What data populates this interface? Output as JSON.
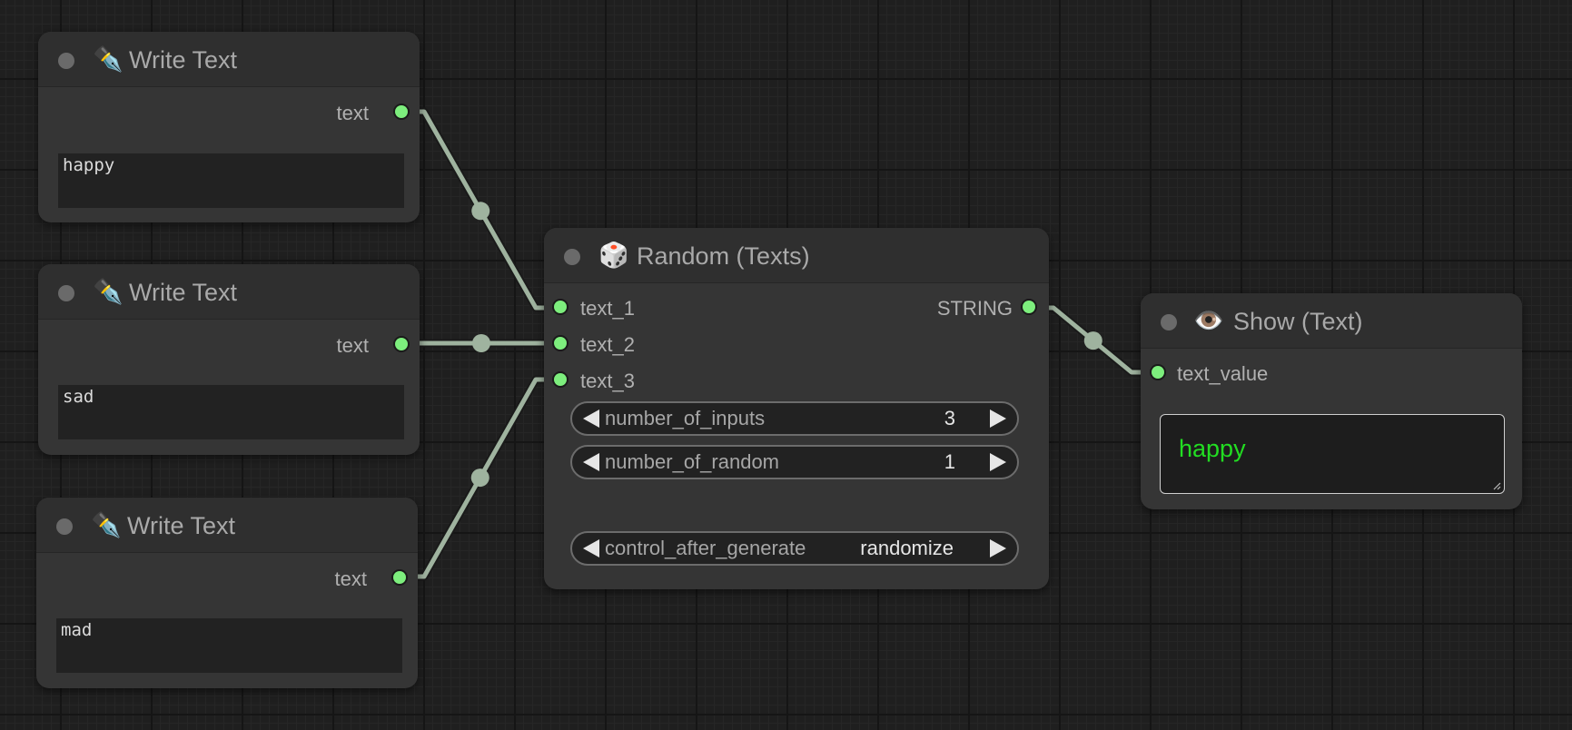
{
  "canvas": {
    "link_color": "#9fb39f",
    "slot_color": "#7dee7d",
    "show_text_color": "#22dd22"
  },
  "write_text_nodes": [
    {
      "icon": "✒️",
      "title": "Write Text",
      "output_label": "text",
      "value": "happy"
    },
    {
      "icon": "✒️",
      "title": "Write Text",
      "output_label": "text",
      "value": "sad"
    },
    {
      "icon": "✒️",
      "title": "Write Text",
      "output_label": "text",
      "value": "mad"
    }
  ],
  "random_node": {
    "icon": "🎲",
    "title": "Random (Texts)",
    "inputs": [
      "text_1",
      "text_2",
      "text_3"
    ],
    "output_label": "STRING",
    "widgets": [
      {
        "name": "number_of_inputs",
        "value": "3"
      },
      {
        "name": "number_of_random",
        "value": "1"
      },
      {
        "name": "control_after_generate",
        "value": "randomize"
      }
    ]
  },
  "show_node": {
    "icon": "👁️",
    "title": "Show (Text)",
    "input_label": "text_value",
    "value": "happy"
  }
}
